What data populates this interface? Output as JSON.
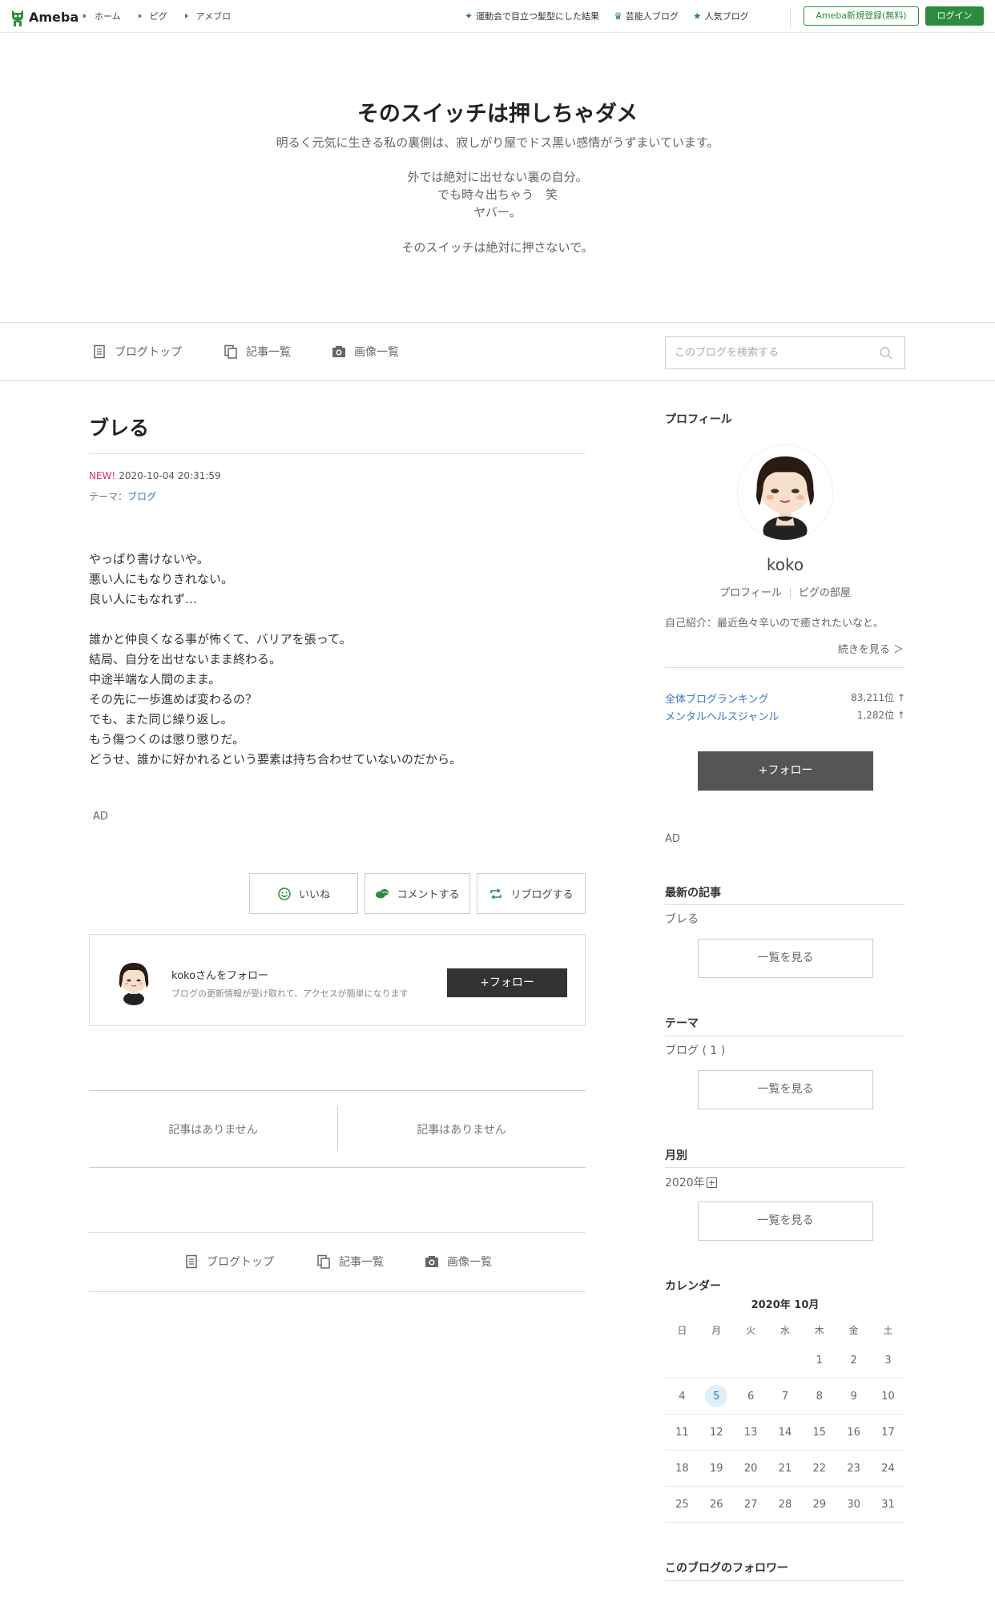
{
  "header": {
    "logo_text": "Ameba",
    "breadcrumbs": [
      "ホーム",
      "ピグ",
      "アメブロ"
    ],
    "links": [
      {
        "icon": "sparkle-icon",
        "label": "運動会で目立つ髪型にした結果"
      },
      {
        "icon": "crown-icon",
        "label": "芸能人ブログ"
      },
      {
        "icon": "star-icon",
        "label": "人気ブログ"
      }
    ],
    "register_label": "Ameba新規登録(無料)",
    "login_label": "ログイン"
  },
  "blog": {
    "title": "そのスイッチは押しちゃダメ",
    "subtitle": "明るく元気に生きる私の裏側は、寂しがり屋でドス黒い感情がうずまいています。",
    "description": "外では絶対に出せない裏の自分。\nでも時々出ちゃう　笑\nヤバー。\n\nそのスイッチは絶対に押さないで。"
  },
  "nav": {
    "items": [
      "ブログトップ",
      "記事一覧",
      "画像一覧"
    ],
    "search_placeholder": "このブログを検索する"
  },
  "article": {
    "title": "ブレる",
    "new_label": "NEW!",
    "datetime": "2020-10-04 20:31:59",
    "theme_label": "テーマ：",
    "theme_link": "ブログ",
    "body": "やっぱり書けないや。\n悪い人にもなりきれない。\n良い人にもなれず…\n\n誰かと仲良くなる事が怖くて、バリアを張って。\n結局、自分を出せないまま終わる。\n中途半端な人間のまま。\nその先に一歩進めば変わるの？\nでも、また同じ繰り返し。\nもう傷つくのは懲り懲りだ。\nどうせ、誰かに好かれるという要素は持ち合わせていないのだから。",
    "ad_label": "AD",
    "actions": [
      "いいね",
      "コメントする",
      "リブログする"
    ],
    "follow_title": "kokoさんをフォロー",
    "follow_desc": "ブログの更新情報が受け取れて、アクセスが簡単になります",
    "follow_button": "+フォロー",
    "related_left": "記事はありません",
    "related_right": "記事はありません"
  },
  "sidebar": {
    "profile_heading": "プロフィール",
    "name": "koko",
    "profile_link": "プロフィール",
    "pigg_link": "ピグの部屋",
    "intro": "自己紹介：最近色々辛いので癒されたいなと。",
    "more": "続きを見る ＞",
    "rankings": [
      {
        "label": "全体ブログランキング",
        "value": "83,211位 ↑"
      },
      {
        "label": "メンタルヘルスジャンル",
        "value": "1,282位 ↑"
      }
    ],
    "follow_button": "+フォロー",
    "ad_label": "AD",
    "latest_heading": "最新の記事",
    "latest_item": "ブレる",
    "list_button": "一覧を見る",
    "theme_heading": "テーマ",
    "theme_item": "ブログ ( 1 )",
    "monthly_heading": "月別",
    "monthly_item": "2020年",
    "calendar_heading": "カレンダー",
    "calendar_month": "2020年 10月",
    "weekdays": [
      "日",
      "月",
      "火",
      "水",
      "木",
      "金",
      "土"
    ],
    "weeks": [
      [
        "",
        "",
        "",
        "",
        "1",
        "2",
        "3"
      ],
      [
        "4",
        "5",
        "6",
        "7",
        "8",
        "9",
        "10"
      ],
      [
        "11",
        "12",
        "13",
        "14",
        "15",
        "16",
        "17"
      ],
      [
        "18",
        "19",
        "20",
        "21",
        "22",
        "23",
        "24"
      ],
      [
        "25",
        "26",
        "27",
        "28",
        "29",
        "30",
        "31"
      ]
    ],
    "today": "5",
    "followers_heading": "このブログのフォロワー"
  },
  "colors": {
    "accent_green": "#2d8c3c",
    "link_blue": "#3675bc",
    "new_pink": "#e0305f",
    "follow_dark": "#333333"
  }
}
